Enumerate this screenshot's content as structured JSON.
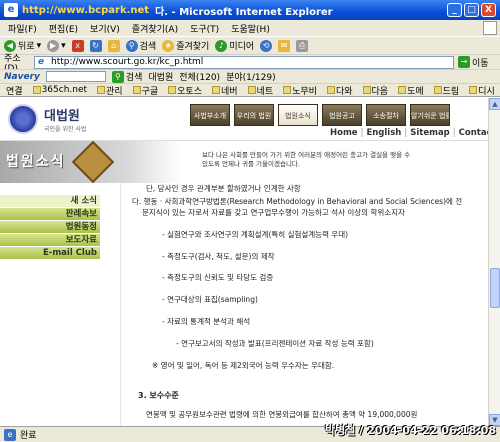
{
  "window": {
    "title_prefix": "http://www.bcpark.net",
    "title": "다. - Microsoft Internet Explorer",
    "watermark": "http://www.bcpark.net",
    "buttons": [
      "_",
      "□",
      "X"
    ]
  },
  "menu": [
    "파일(F)",
    "편집(E)",
    "보기(V)",
    "즐겨찾기(A)",
    "도구(T)",
    "도움말(H)"
  ],
  "toolbar": {
    "back": "뒤로",
    "search": "검색",
    "favorites": "즐겨찾기",
    "media": "미디어"
  },
  "address": {
    "label": "주소(D)",
    "url": "http://www.scourt.go.kr/kc_p.html",
    "go": "이동"
  },
  "naver": {
    "brand": "Navery",
    "search": "검색",
    "dictionary": "대법원",
    "all": "전체(120)",
    "category": "분야(1/129)"
  },
  "links": [
    "연결",
    "365ch.net",
    "관리",
    "구글",
    "오토스",
    "네버",
    "네트",
    "노무비",
    "다와",
    "다음",
    "도메",
    "드림",
    "디시"
  ],
  "site": {
    "logo": "대법원",
    "logo_sub": "국민을 위한 사법",
    "nav_tiles": [
      "사법부소개",
      "우리의 법원",
      "법원소식",
      "법원공고",
      "소송절차",
      "알기쉬운 법률용어"
    ],
    "util_links": [
      "Home",
      "English",
      "Sitemap",
      "Contact us"
    ],
    "banner_title": "법원소식",
    "banner_quote": "보다 나은 사회를 만들어 가기 위한 여러분의 애정어린 충고가 결실을 맺을 수 있도록 언제나 귀를 기울이겠습니다."
  },
  "sidemenu": [
    "새 소식",
    "판례속보",
    "법원동정",
    "보도자료",
    "E-mail Club"
  ],
  "content": {
    "line0": "단, 당사인 경우 관계부분 할하였거나 인계한 사항",
    "para1a": "다. 행동 · 사회과학연구방법론(Research Methodology in Behavioral and Social Sciences)에 전",
    "para1b": "문지식이 있는 자로서 자료를 갖고 연구업무수행이 가능하고 석사 이상의 학위소지자",
    "bullets": [
      "- 실험연구와 조사연구의 계획설계(특히 실험설계능력 우대)",
      "- 측정도구(검사, 척도, 설문)의 제작",
      "- 측정도구의 신뢰도 및 타당도 검증",
      "- 연구대상의 표집(sampling)",
      "- 자료의 통계적 분석과 해석"
    ],
    "sub": "- 연구보고서의 작성과 발표(프리젠테이션 자료 작성 능력 포함)",
    "note": "※ 영어 및 일어, 독어 등 제2외국어 능력 우수자는 우대함.",
    "section": "3. 보수수준",
    "money": "연봉액 및 공무원보수관련 법령에 의한 연봉외급여를 합산하여 총액 약 19,000,000원"
  },
  "status": {
    "text": "완료",
    "stamp": "박병철 / 2004-04-22 06:18:08"
  }
}
